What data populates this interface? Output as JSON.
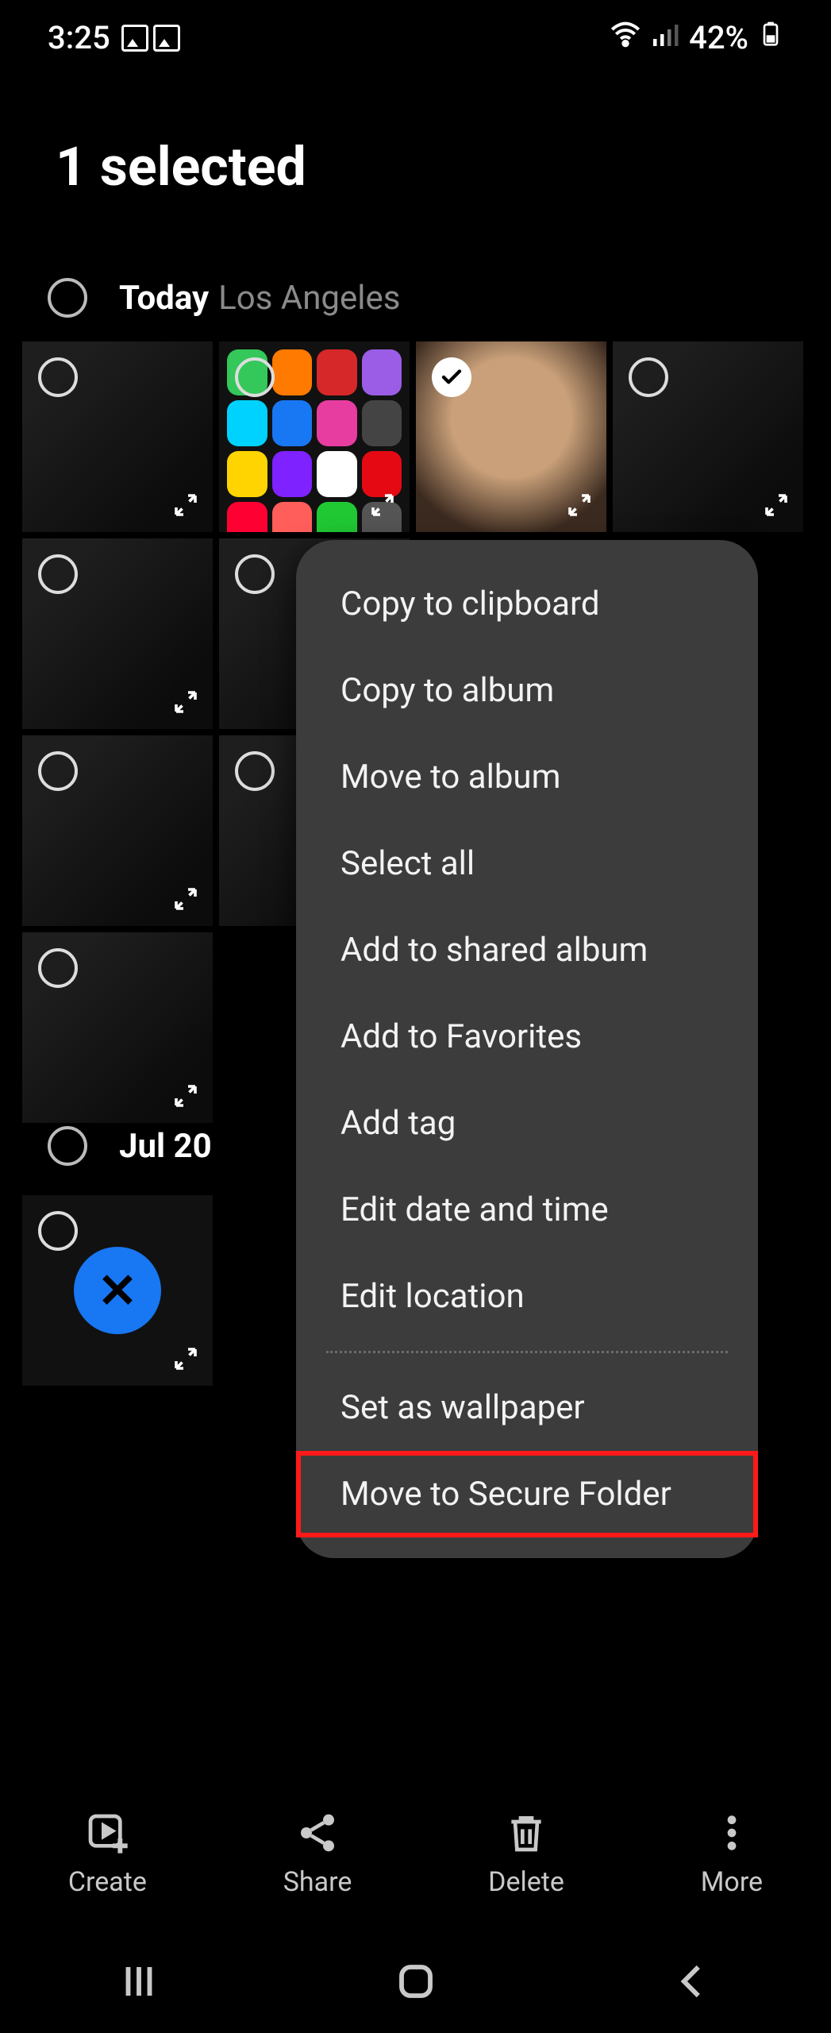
{
  "status": {
    "time": "3:25",
    "battery": "42%"
  },
  "header": {
    "title": "1 selected"
  },
  "sections": {
    "today": {
      "title": "Today",
      "subtitle": "Los Angeles"
    },
    "jul20": {
      "title": "Jul 20"
    }
  },
  "menu": {
    "items": [
      "Copy to clipboard",
      "Copy to album",
      "Move to album",
      "Select all",
      "Add to shared album",
      "Add to Favorites",
      "Add tag",
      "Edit date and time",
      "Edit location"
    ],
    "items2": [
      "Set as wallpaper",
      "Move to Secure Folder"
    ]
  },
  "actions": {
    "create": "Create",
    "share": "Share",
    "delete": "Delete",
    "more": "More"
  }
}
